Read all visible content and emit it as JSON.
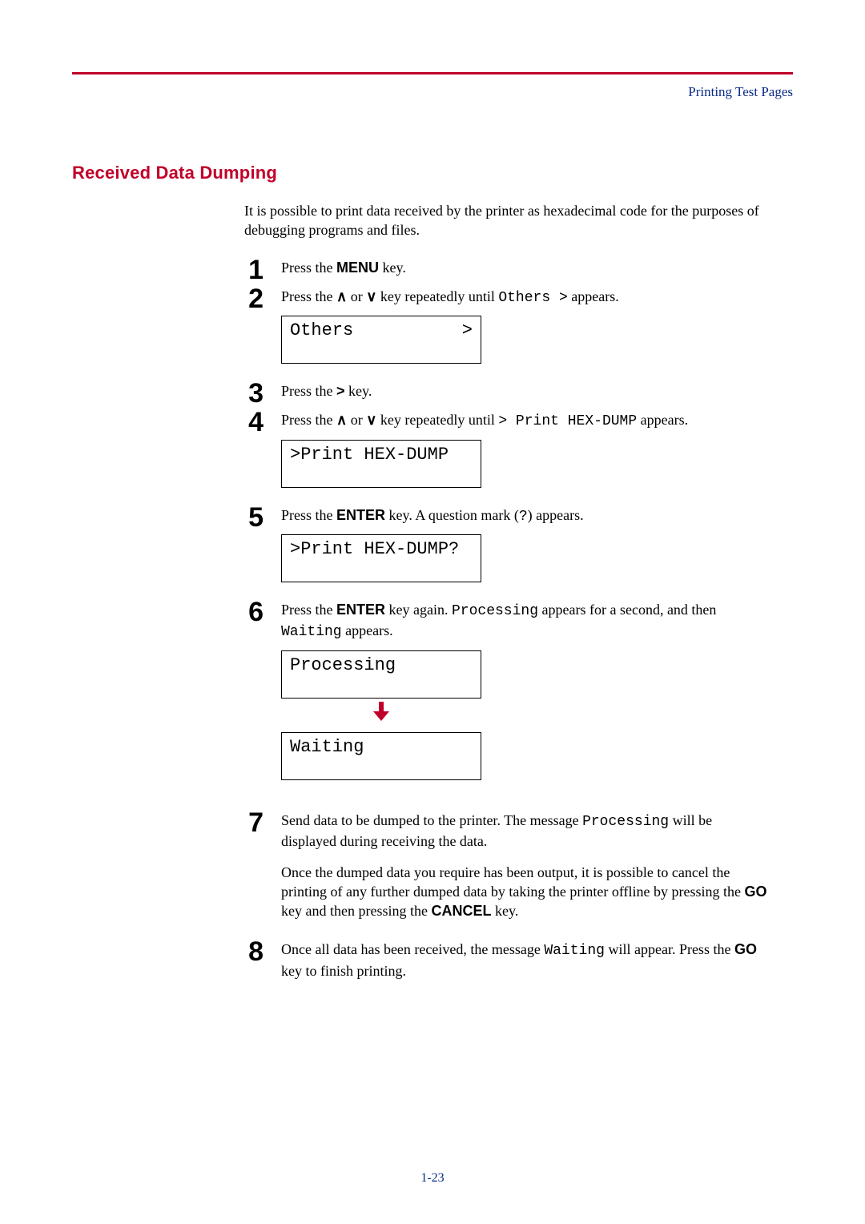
{
  "header": {
    "section_label": "Printing Test Pages"
  },
  "title": "Received Data Dumping",
  "intro": "It is possible to print data received by the printer as hexadecimal code for the purposes of debugging programs and files.",
  "steps": {
    "s1": {
      "num": "1",
      "t1": "Press the ",
      "key": "MENU",
      "t2": " key."
    },
    "s2": {
      "num": "2",
      "t1": "Press the ",
      "t_or": " or ",
      "t2": " key repeatedly until ",
      "code": "Others >",
      "t3": " appears.",
      "lcd_left": "Others",
      "lcd_right": ">"
    },
    "s3": {
      "num": "3",
      "t1": "Press the ",
      "key": ">",
      "t2": " key."
    },
    "s4": {
      "num": "4",
      "t1": "Press the ",
      "t_or": " or ",
      "t2": " key repeatedly until ",
      "code": "> Print HEX-DUMP",
      "t3": " appears.",
      "lcd": ">Print HEX-DUMP"
    },
    "s5": {
      "num": "5",
      "t1": "Press the ",
      "key": "ENTER",
      "t2": " key. A question mark (",
      "qm": "?",
      "t3": ") appears.",
      "lcd": ">Print HEX-DUMP?"
    },
    "s6": {
      "num": "6",
      "t1": "Press the ",
      "key": "ENTER",
      "t2": " key again. ",
      "code1": "Processing",
      "t3": " appears for a second, and then ",
      "code2": "Waiting",
      "t4": " appears.",
      "lcd1": "Processing",
      "lcd2": "Waiting"
    },
    "s7": {
      "num": "7",
      "p1a": "Send data to be dumped to the printer. The message ",
      "p1code": "Processing",
      "p1b": " will be displayed during receiving the data.",
      "p2a": "Once the dumped data you require has been output, it is possible to cancel the printing of any further dumped data by taking the printer offline by pressing the ",
      "key1": "GO",
      "p2b": " key and then pressing the ",
      "key2": "CANCEL",
      "p2c": " key."
    },
    "s8": {
      "num": "8",
      "t1": "Once all data has been received, the message ",
      "code": "Waiting",
      "t2": " will appear. Press the ",
      "key": "GO",
      "t3": " key to finish printing."
    }
  },
  "symbols": {
    "up_caret": "∧",
    "down_caret": "∨"
  },
  "footer": {
    "page": "1-23"
  }
}
